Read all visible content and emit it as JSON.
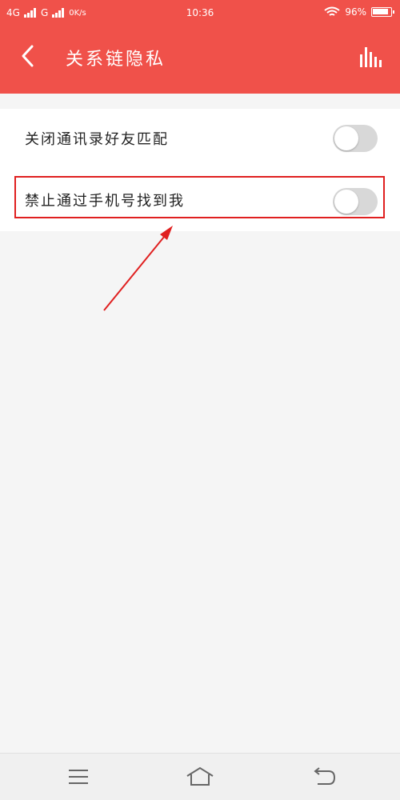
{
  "status_bar": {
    "net1": "4G",
    "net2": "G",
    "speed": "0K/s",
    "time": "10:36",
    "battery": "96%",
    "battery_level": 0.96
  },
  "header": {
    "title": "关系链隐私",
    "back_icon": "chevron-left-icon",
    "stats_icon": "bar-chart-icon"
  },
  "settings": [
    {
      "label": "关闭通讯录好友匹配",
      "enabled": false
    },
    {
      "label": "禁止通过手机号找到我",
      "enabled": false
    }
  ],
  "nav": {
    "menu_icon": "menu-icon",
    "home_icon": "home-icon",
    "back_icon": "back-icon"
  },
  "colors": {
    "accent": "#f0514a",
    "annotation": "#e02020",
    "toggle_off": "#d8d8d8"
  }
}
